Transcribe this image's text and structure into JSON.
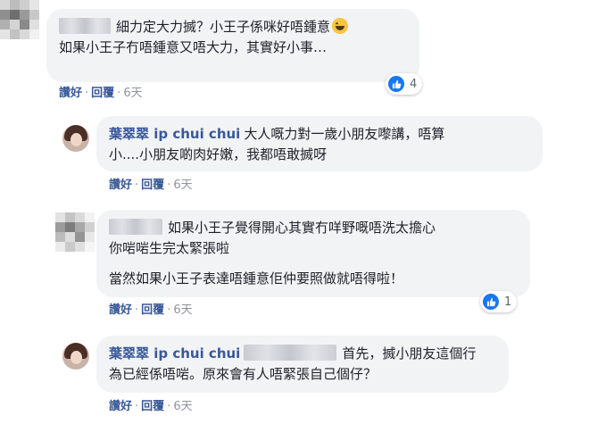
{
  "comments": [
    {
      "author": "",
      "lines": [
        "細力定大力搣？小王子係咪好唔鍾意",
        "如果小王子冇唔鍾意又唔大力，其實好小事…"
      ],
      "emoji": "grinning-sweat-emoji",
      "actions": {
        "like": "讚好",
        "reply": "回覆",
        "time": "6天"
      },
      "reaction_count": "4"
    },
    {
      "author": "葉翠翠 ip chui chui",
      "lines": [
        "大人嘅力對一歲小朋友嚟講，唔算",
        "小....小朋友啲肉好嫩，我都唔敢搣呀"
      ],
      "actions": {
        "like": "讚好",
        "reply": "回覆",
        "time": "6天"
      }
    },
    {
      "author": "",
      "lines": [
        "如果小王子覺得開心其實冇咩野嘅唔洗太擔心",
        "你啱啱生完太緊張啦",
        "當然如果小王子表達唔鍾意佢仲要照做就唔得啦！"
      ],
      "actions": {
        "like": "讚好",
        "reply": "回覆",
        "time": "6天"
      },
      "reaction_count": "1"
    },
    {
      "author": "葉翠翠 ip chui chui",
      "lines": [
        "首先，搣小朋友這個行",
        "為已經係唔啱。原來會有人唔緊張自己個仔？"
      ],
      "actions": {
        "like": "讚好",
        "reply": "回覆",
        "time": "6天"
      }
    }
  ],
  "colors": {
    "name": "#385898",
    "bubble": "#f2f3f5",
    "like_blue": "#1877f2",
    "meta_gray": "#90949c"
  }
}
